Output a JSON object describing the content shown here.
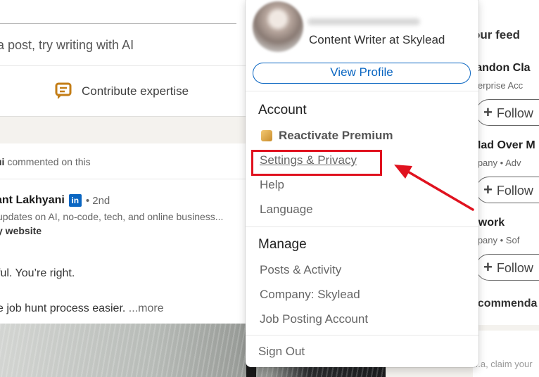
{
  "composer": {
    "placeholder": "t a post, try writing with AI",
    "contribute_label": "Contribute expertise",
    "contribute_icon": "contribute-expertise-icon"
  },
  "post": {
    "context_name": "ui",
    "context_action": "commented on this",
    "author_name": "ant Lakhyani",
    "badge": "in",
    "degree": "• 2nd",
    "headline": "updates on AI, no-code, tech, and online business...",
    "website": "y website",
    "line1": "ful. You’re right.",
    "line2": "e job hunt process easier.",
    "more": "...more"
  },
  "right_feed": {
    "title": "our feed",
    "recommendations": [
      {
        "name": "randon Cla",
        "sub": "nterprise Acc",
        "follow_label": "Follow"
      },
      {
        "name": "Mad Over M",
        "sub": "mpany • Adv",
        "follow_label": "Follow"
      },
      {
        "name": "pwork",
        "sub": "mpany • Sof",
        "follow_label": "Follow"
      }
    ],
    "recommend_text": "ecommenda",
    "claim_text": "...a, claim your"
  },
  "dropdown": {
    "headline": "Content Writer at Skylead",
    "view_profile_label": "View Profile",
    "account_heading": "Account",
    "account_items": [
      "Reactivate Premium",
      "Settings & Privacy",
      "Help",
      "Language"
    ],
    "manage_heading": "Manage",
    "manage_items": [
      "Posts & Activity",
      "Company: Skylead",
      "Job Posting Account"
    ],
    "sign_out_label": "Sign Out"
  },
  "annotation": {
    "highlight_color": "#e0121f",
    "arrow_color": "#e0121f"
  },
  "colors": {
    "brand_blue": "#0a66c2",
    "page_bg": "#f4f2ee"
  }
}
